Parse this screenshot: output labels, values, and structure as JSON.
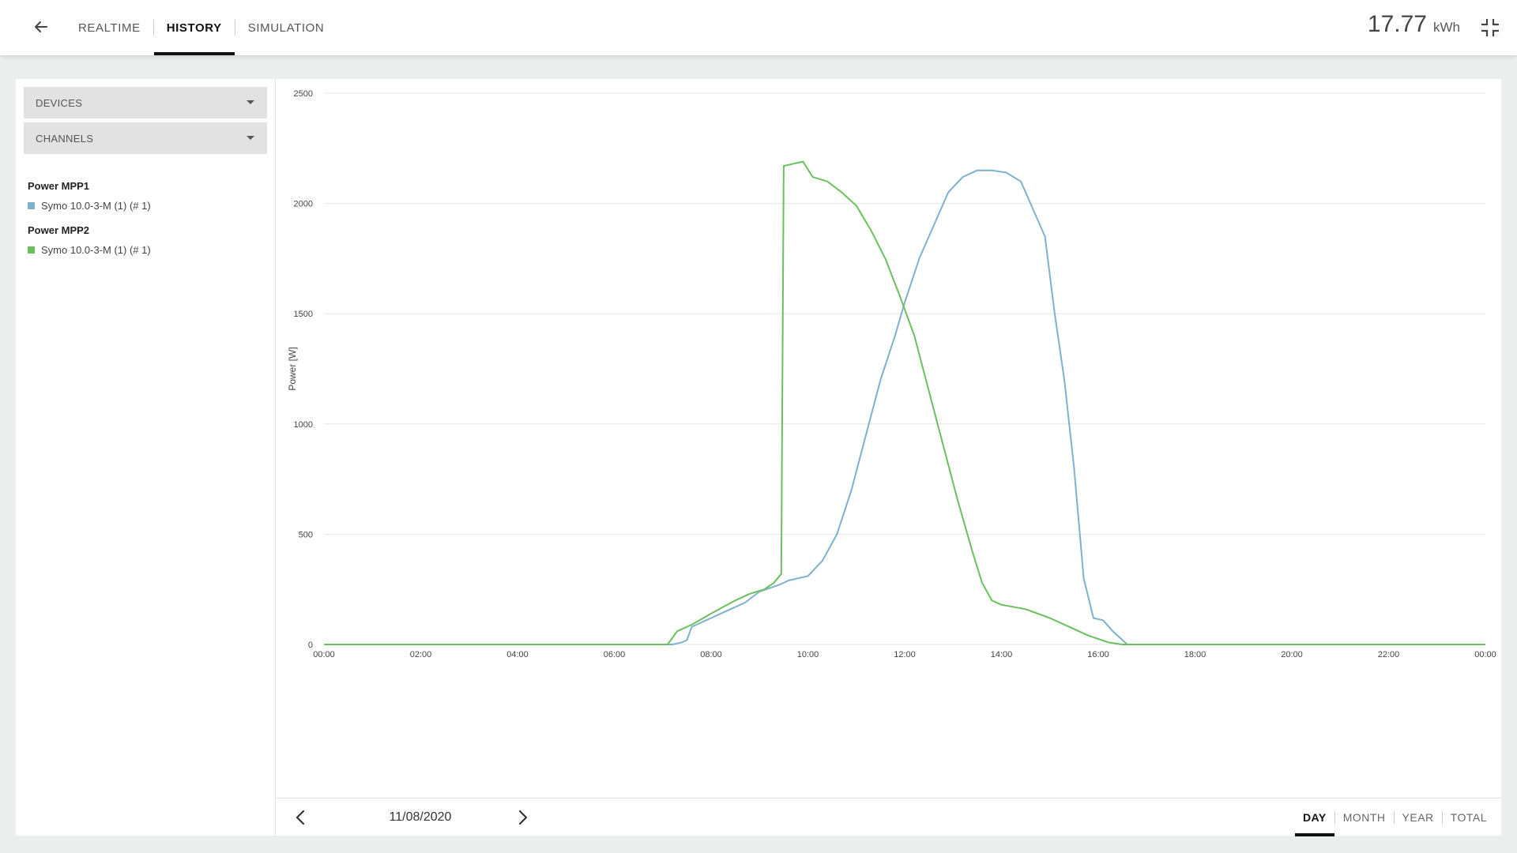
{
  "nav": {
    "back_icon": "arrow-left-icon",
    "tabs": [
      {
        "label": "REALTIME",
        "active": false
      },
      {
        "label": "HISTORY",
        "active": true
      },
      {
        "label": "SIMULATION",
        "active": false
      }
    ]
  },
  "energy": {
    "value": "17.77",
    "unit": "kWh"
  },
  "collapse_icon": "collapse-fullscreen-icon",
  "filters": {
    "devices_label": "DEVICES",
    "channels_label": "CHANNELS"
  },
  "legend": [
    {
      "title": "Power MPP1",
      "item": "Symo 10.0-3-M (1) (# 1)",
      "color": "#7fb1cc"
    },
    {
      "title": "Power MPP2",
      "item": "Symo 10.0-3-M (1) (# 1)",
      "color": "#6abf5e"
    }
  ],
  "footer": {
    "date": "11/08/2020",
    "prev_icon": "chevron-left-icon",
    "next_icon": "chevron-right-icon",
    "periods": [
      {
        "label": "DAY",
        "active": true
      },
      {
        "label": "MONTH",
        "active": false
      },
      {
        "label": "YEAR",
        "active": false
      },
      {
        "label": "TOTAL",
        "active": false
      }
    ]
  },
  "chart_data": {
    "type": "line",
    "ylabel": "Power [W]",
    "xlabel": "",
    "ylim": [
      0,
      2500
    ],
    "xlim": [
      0,
      24
    ],
    "yticks": [
      0,
      500,
      1000,
      1500,
      2000,
      2500
    ],
    "xtick_labels": [
      "00:00",
      "02:00",
      "04:00",
      "06:00",
      "08:00",
      "10:00",
      "12:00",
      "14:00",
      "16:00",
      "18:00",
      "20:00",
      "22:00",
      "00:00"
    ],
    "grid": true,
    "series": [
      {
        "name": "Power MPP1",
        "color": "#7fb1cc",
        "points": [
          [
            0,
            0
          ],
          [
            7.2,
            0
          ],
          [
            7.4,
            10
          ],
          [
            7.5,
            20
          ],
          [
            7.6,
            80
          ],
          [
            8.0,
            120
          ],
          [
            8.4,
            160
          ],
          [
            8.7,
            190
          ],
          [
            9.0,
            240
          ],
          [
            9.4,
            270
          ],
          [
            9.6,
            290
          ],
          [
            10.0,
            310
          ],
          [
            10.3,
            380
          ],
          [
            10.6,
            500
          ],
          [
            10.9,
            700
          ],
          [
            11.2,
            950
          ],
          [
            11.5,
            1200
          ],
          [
            11.8,
            1400
          ],
          [
            12.0,
            1550
          ],
          [
            12.3,
            1750
          ],
          [
            12.6,
            1900
          ],
          [
            12.9,
            2050
          ],
          [
            13.2,
            2120
          ],
          [
            13.5,
            2150
          ],
          [
            13.8,
            2150
          ],
          [
            14.1,
            2140
          ],
          [
            14.4,
            2100
          ],
          [
            14.7,
            1950
          ],
          [
            14.9,
            1850
          ],
          [
            15.1,
            1500
          ],
          [
            15.3,
            1200
          ],
          [
            15.5,
            800
          ],
          [
            15.7,
            300
          ],
          [
            15.9,
            120
          ],
          [
            16.1,
            110
          ],
          [
            16.3,
            60
          ],
          [
            16.6,
            0
          ],
          [
            24,
            0
          ]
        ]
      },
      {
        "name": "Power MPP2",
        "color": "#6abf5e",
        "points": [
          [
            0,
            0
          ],
          [
            7.1,
            0
          ],
          [
            7.3,
            60
          ],
          [
            7.6,
            90
          ],
          [
            8.0,
            140
          ],
          [
            8.5,
            200
          ],
          [
            8.8,
            230
          ],
          [
            9.1,
            250
          ],
          [
            9.3,
            280
          ],
          [
            9.45,
            320
          ],
          [
            9.5,
            2170
          ],
          [
            9.7,
            2180
          ],
          [
            9.9,
            2190
          ],
          [
            10.1,
            2120
          ],
          [
            10.4,
            2100
          ],
          [
            10.7,
            2050
          ],
          [
            11.0,
            1990
          ],
          [
            11.3,
            1880
          ],
          [
            11.6,
            1750
          ],
          [
            11.9,
            1580
          ],
          [
            12.2,
            1400
          ],
          [
            12.5,
            1150
          ],
          [
            12.8,
            900
          ],
          [
            13.1,
            650
          ],
          [
            13.4,
            420
          ],
          [
            13.6,
            280
          ],
          [
            13.8,
            200
          ],
          [
            14.0,
            180
          ],
          [
            14.5,
            160
          ],
          [
            15.0,
            120
          ],
          [
            15.4,
            80
          ],
          [
            15.8,
            40
          ],
          [
            16.2,
            10
          ],
          [
            16.5,
            0
          ],
          [
            24,
            0
          ]
        ]
      }
    ]
  }
}
